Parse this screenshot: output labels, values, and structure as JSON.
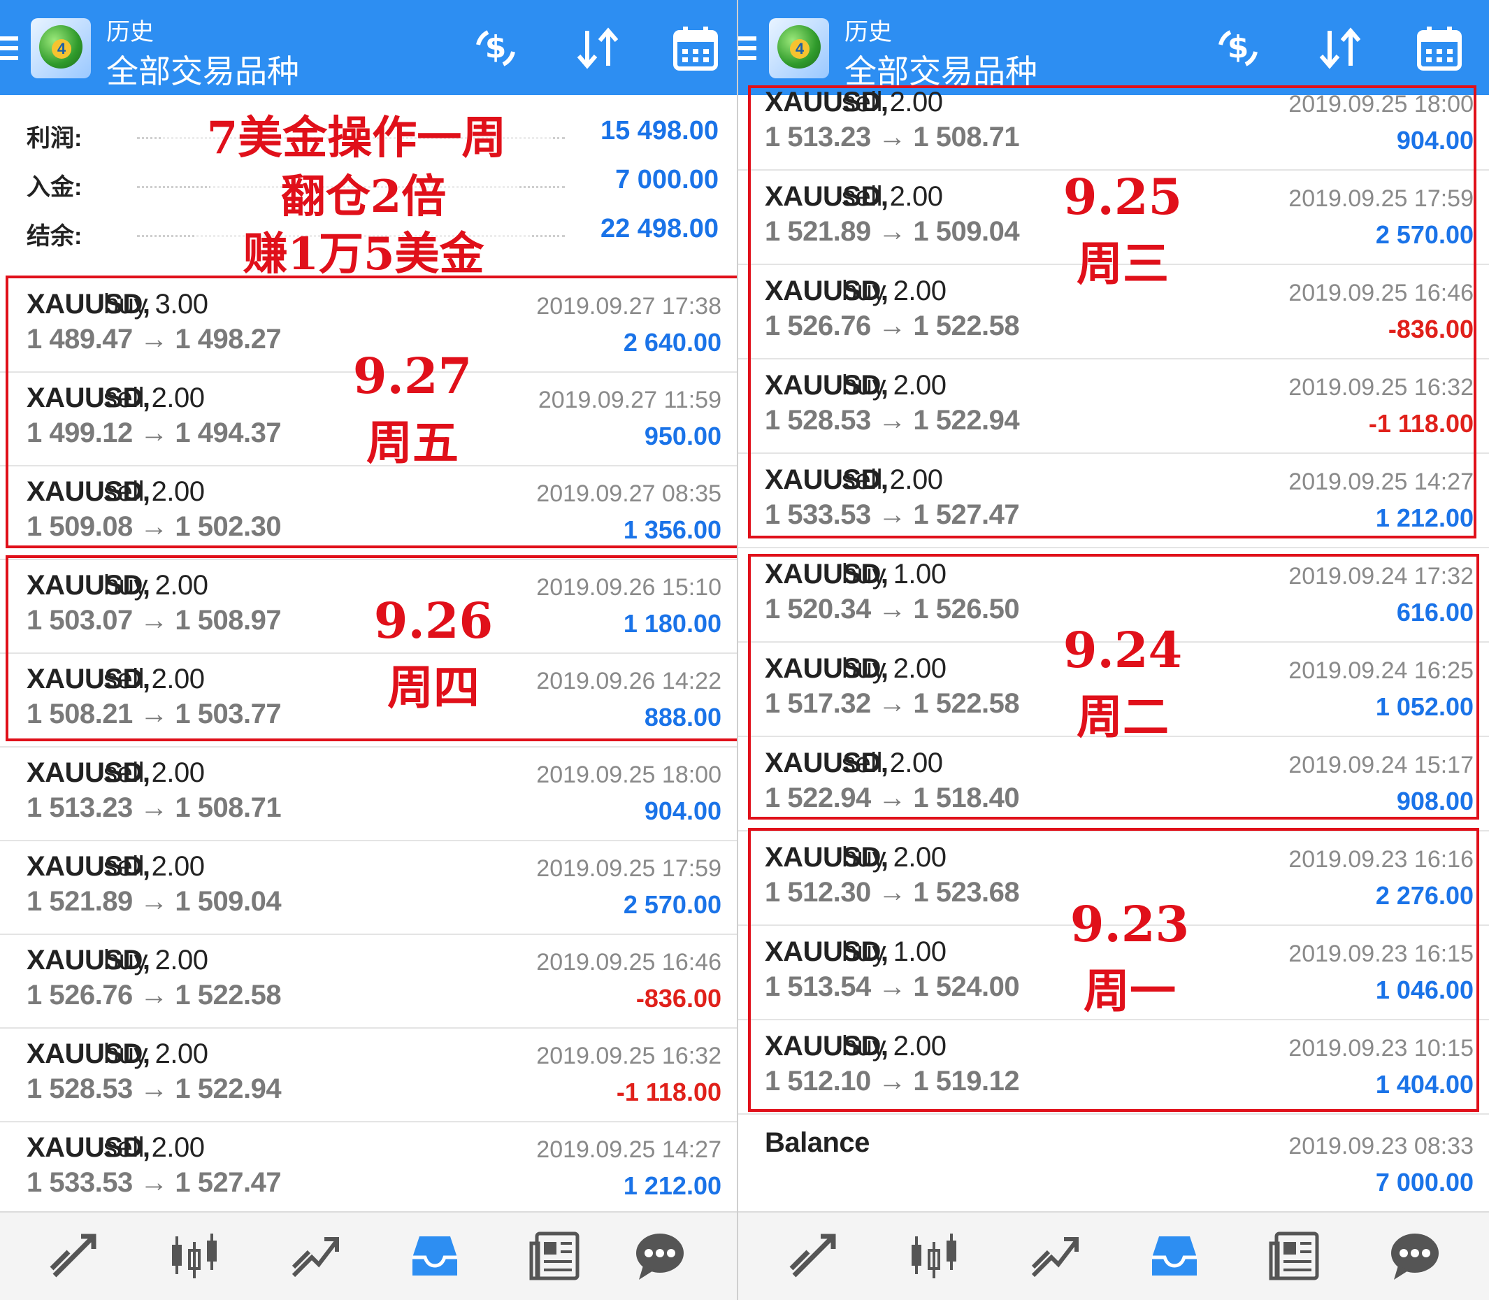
{
  "header": {
    "subtitle": "历史",
    "title": "全部交易品种"
  },
  "summary": {
    "profit_label": "利润:",
    "profit_value": "15 498.00",
    "deposit_label": "入金:",
    "deposit_value": "7 000.00",
    "balance_label": "结余:",
    "balance_value": "22 498.00"
  },
  "annotations": {
    "headline_1": "7美金操作一周",
    "headline_2": "翻仓2倍",
    "headline_3": "赚1万5美金",
    "d0927": "9.27",
    "w0927": "周五",
    "d0926": "9.26",
    "w0926": "周四",
    "d0925": "9.25",
    "w0925": "周三",
    "d0924": "9.24",
    "w0924": "周二",
    "d0923": "9.23",
    "w0923": "周一"
  },
  "left_trades": [
    {
      "symbol": "XAUUSD,",
      "side": "buy 3.00",
      "prices": "1 489.47 → 1 498.27",
      "time": "2019.09.27 17:38",
      "profit": "2 640.00"
    },
    {
      "symbol": "XAUUSD,",
      "side": "sell 2.00",
      "prices": "1 499.12 → 1 494.37",
      "time": "2019.09.27 11:59",
      "profit": "950.00"
    },
    {
      "symbol": "XAUUSD,",
      "side": "sell 2.00",
      "prices": "1 509.08 → 1 502.30",
      "time": "2019.09.27 08:35",
      "profit": "1 356.00"
    },
    {
      "symbol": "XAUUSD,",
      "side": "buy 2.00",
      "prices": "1 503.07 → 1 508.97",
      "time": "2019.09.26 15:10",
      "profit": "1 180.00"
    },
    {
      "symbol": "XAUUSD,",
      "side": "sell 2.00",
      "prices": "1 508.21 → 1 503.77",
      "time": "2019.09.26 14:22",
      "profit": "888.00"
    },
    {
      "symbol": "XAUUSD,",
      "side": "sell 2.00",
      "prices": "1 513.23 → 1 508.71",
      "time": "2019.09.25 18:00",
      "profit": "904.00"
    },
    {
      "symbol": "XAUUSD,",
      "side": "sell 2.00",
      "prices": "1 521.89 → 1 509.04",
      "time": "2019.09.25 17:59",
      "profit": "2 570.00"
    },
    {
      "symbol": "XAUUSD,",
      "side": "buy 2.00",
      "prices": "1 526.76 → 1 522.58",
      "time": "2019.09.25 16:46",
      "profit": "-836.00"
    },
    {
      "symbol": "XAUUSD,",
      "side": "buy 2.00",
      "prices": "1 528.53 → 1 522.94",
      "time": "2019.09.25 16:32",
      "profit": "-1 118.00"
    },
    {
      "symbol": "XAUUSD,",
      "side": "sell 2.00",
      "prices": "1 533.53 → 1 527.47",
      "time": "2019.09.25 14:27",
      "profit": "1 212.00"
    }
  ],
  "right_trades": [
    {
      "symbol": "XAUUSD,",
      "side": "sell 2.00",
      "prices": "1 513.23 → 1 508.71",
      "time": "2019.09.25 18:00",
      "profit": "904.00"
    },
    {
      "symbol": "XAUUSD,",
      "side": "sell 2.00",
      "prices": "1 521.89 → 1 509.04",
      "time": "2019.09.25 17:59",
      "profit": "2 570.00"
    },
    {
      "symbol": "XAUUSD,",
      "side": "buy 2.00",
      "prices": "1 526.76 → 1 522.58",
      "time": "2019.09.25 16:46",
      "profit": "-836.00"
    },
    {
      "symbol": "XAUUSD,",
      "side": "buy 2.00",
      "prices": "1 528.53 → 1 522.94",
      "time": "2019.09.25 16:32",
      "profit": "-1 118.00"
    },
    {
      "symbol": "XAUUSD,",
      "side": "sell 2.00",
      "prices": "1 533.53 → 1 527.47",
      "time": "2019.09.25 14:27",
      "profit": "1 212.00"
    },
    {
      "symbol": "XAUUSD,",
      "side": "buy 1.00",
      "prices": "1 520.34 → 1 526.50",
      "time": "2019.09.24 17:32",
      "profit": "616.00"
    },
    {
      "symbol": "XAUUSD,",
      "side": "buy 2.00",
      "prices": "1 517.32 → 1 522.58",
      "time": "2019.09.24 16:25",
      "profit": "1 052.00"
    },
    {
      "symbol": "XAUUSD,",
      "side": "sell 2.00",
      "prices": "1 522.94 → 1 518.40",
      "time": "2019.09.24 15:17",
      "profit": "908.00"
    },
    {
      "symbol": "XAUUSD,",
      "side": "buy 2.00",
      "prices": "1 512.30 → 1 523.68",
      "time": "2019.09.23 16:16",
      "profit": "2 276.00"
    },
    {
      "symbol": "XAUUSD,",
      "side": "buy 1.00",
      "prices": "1 513.54 → 1 524.00",
      "time": "2019.09.23 16:15",
      "profit": "1 046.00"
    },
    {
      "symbol": "XAUUSD,",
      "side": "buy 2.00",
      "prices": "1 512.10 → 1 519.12",
      "time": "2019.09.23 10:15",
      "profit": "1 404.00"
    }
  ],
  "balance_row": {
    "label": "Balance",
    "time": "2019.09.23 08:33",
    "amount": "7 000.00"
  },
  "toolbar_icons": [
    "dollar-swap-icon",
    "sort-icon",
    "calendar-icon"
  ],
  "nav_icons": [
    "trade-icon",
    "quotes-icon",
    "chart-icon",
    "history-icon",
    "news-icon",
    "chat-icon"
  ],
  "colors": {
    "header": "#2d8ef2",
    "buy": "#1a73e8",
    "sell": "#e0201a",
    "annotation": "#e0101a"
  }
}
